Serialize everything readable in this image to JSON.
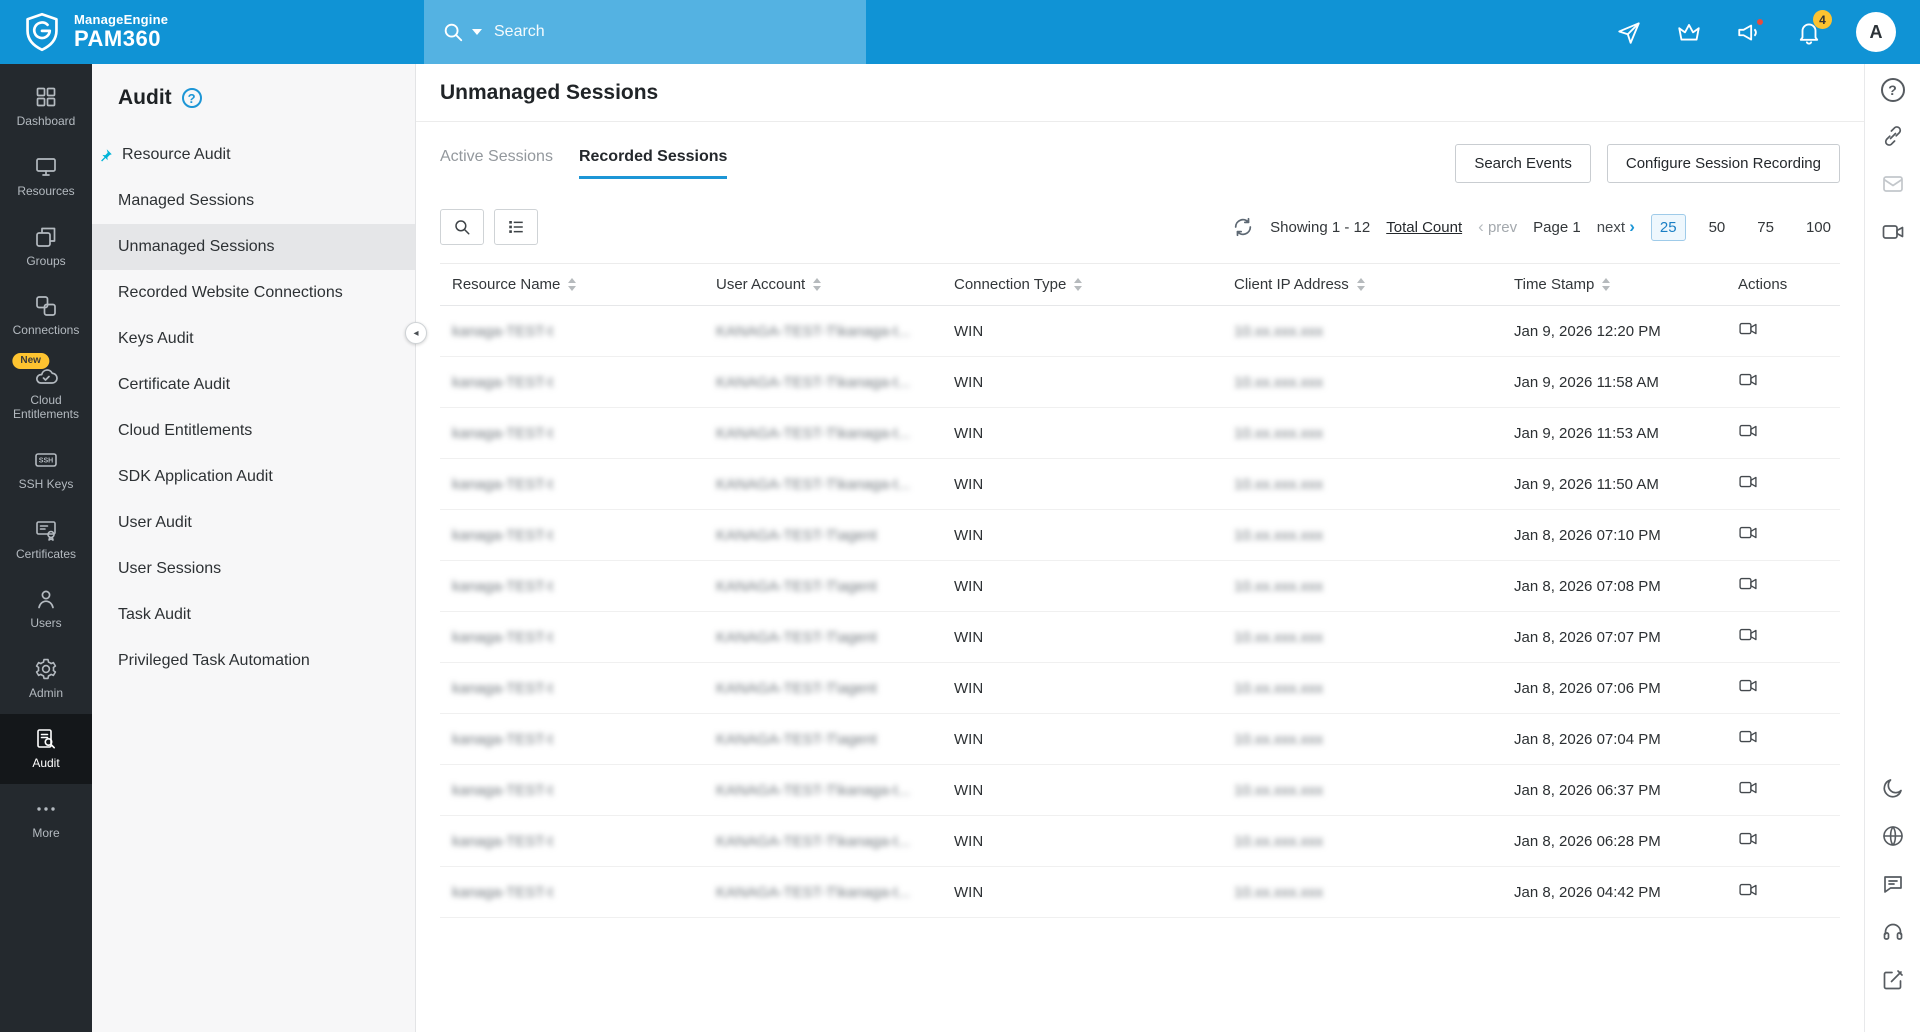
{
  "colors": {
    "topbar_blue": "#1093d5",
    "accent_blue": "#1d96d6",
    "badge_yellow": "#fdc330",
    "alert_red": "#e84c3d",
    "nav_dark": "#24292e"
  },
  "topbar": {
    "brand_line1": "ManageEngine",
    "brand_line2": "PAM360",
    "search_placeholder": "Search",
    "icons": [
      "search-icon",
      "send-icon",
      "crown-icon",
      "announcement-icon",
      "bell-icon"
    ],
    "bell_badge": "4",
    "avatar_letter": "A"
  },
  "nav": {
    "items": [
      {
        "label": "Dashboard",
        "icon": "dashboard-icon"
      },
      {
        "label": "Resources",
        "icon": "resources-icon"
      },
      {
        "label": "Groups",
        "icon": "groups-icon"
      },
      {
        "label": "Connections",
        "icon": "connections-icon"
      },
      {
        "label": "Cloud Entitlements",
        "icon": "cloud-icon",
        "badge": "New"
      },
      {
        "label": "SSH Keys",
        "icon": "ssh-keys-icon"
      },
      {
        "label": "Certificates",
        "icon": "certificates-icon"
      },
      {
        "label": "Users",
        "icon": "users-icon"
      },
      {
        "label": "Admin",
        "icon": "gear-icon"
      },
      {
        "label": "Audit",
        "icon": "audit-icon",
        "active": true
      },
      {
        "label": "More",
        "icon": "more-icon"
      }
    ]
  },
  "sidebar": {
    "title": "Audit",
    "help_icon": "help-icon",
    "items": [
      {
        "label": "Resource Audit",
        "pinned": true
      },
      {
        "label": "Managed Sessions"
      },
      {
        "label": "Unmanaged Sessions",
        "active": true
      },
      {
        "label": "Recorded Website Connections"
      },
      {
        "label": "Keys Audit"
      },
      {
        "label": "Certificate Audit"
      },
      {
        "label": "Cloud Entitlements"
      },
      {
        "label": "SDK Application Audit"
      },
      {
        "label": "User Audit"
      },
      {
        "label": "User Sessions"
      },
      {
        "label": "Task Audit"
      },
      {
        "label": "Privileged Task Automation"
      }
    ]
  },
  "main": {
    "page_title": "Unmanaged Sessions",
    "tabs": [
      {
        "label": "Active Sessions",
        "active": false
      },
      {
        "label": "Recorded Sessions",
        "active": true
      }
    ],
    "actions": {
      "search_events": "Search Events",
      "configure": "Configure Session Recording"
    },
    "pagination": {
      "showing": "Showing 1 - 12",
      "total_link": "Total Count",
      "prev_label": "prev",
      "page_label": "Page 1",
      "next_label": "next",
      "page_sizes": [
        "25",
        "50",
        "75",
        "100"
      ],
      "selected_size": "25"
    },
    "table": {
      "headers": [
        {
          "label": "Resource Name",
          "sortable": true
        },
        {
          "label": "User Account",
          "sortable": true
        },
        {
          "label": "Connection Type",
          "sortable": true
        },
        {
          "label": "Client IP Address",
          "sortable": true
        },
        {
          "label": "Time Stamp",
          "sortable": true
        },
        {
          "label": "Actions",
          "sortable": false
        }
      ],
      "redacted_columns": [
        "Resource Name",
        "User Account",
        "Client IP Address"
      ],
      "rows": [
        {
          "resource": "kanaga-TEST-t",
          "account": "KANAGA-TEST-T\\kanaga-t...",
          "connection_type": "WIN",
          "client_ip": "10.xx.xxx.xxx",
          "time_stamp": "Jan 9, 2026 12:20 PM"
        },
        {
          "resource": "kanaga-TEST-t",
          "account": "KANAGA-TEST-T\\kanaga-t...",
          "connection_type": "WIN",
          "client_ip": "10.xx.xxx.xxx",
          "time_stamp": "Jan 9, 2026 11:58 AM"
        },
        {
          "resource": "kanaga-TEST-t",
          "account": "KANAGA-TEST-T\\kanaga-t...",
          "connection_type": "WIN",
          "client_ip": "10.xx.xxx.xxx",
          "time_stamp": "Jan 9, 2026 11:53 AM"
        },
        {
          "resource": "kanaga-TEST-t",
          "account": "KANAGA-TEST-T\\kanaga-t...",
          "connection_type": "WIN",
          "client_ip": "10.xx.xxx.xxx",
          "time_stamp": "Jan 9, 2026 11:50 AM"
        },
        {
          "resource": "kanaga-TEST-t",
          "account": "KANAGA-TEST-T\\agent",
          "connection_type": "WIN",
          "client_ip": "10.xx.xxx.xxx",
          "time_stamp": "Jan 8, 2026 07:10 PM"
        },
        {
          "resource": "kanaga-TEST-t",
          "account": "KANAGA-TEST-T\\agent",
          "connection_type": "WIN",
          "client_ip": "10.xx.xxx.xxx",
          "time_stamp": "Jan 8, 2026 07:08 PM"
        },
        {
          "resource": "kanaga-TEST-t",
          "account": "KANAGA-TEST-T\\agent",
          "connection_type": "WIN",
          "client_ip": "10.xx.xxx.xxx",
          "time_stamp": "Jan 8, 2026 07:07 PM"
        },
        {
          "resource": "kanaga-TEST-t",
          "account": "KANAGA-TEST-T\\agent",
          "connection_type": "WIN",
          "client_ip": "10.xx.xxx.xxx",
          "time_stamp": "Jan 8, 2026 07:06 PM"
        },
        {
          "resource": "kanaga-TEST-t",
          "account": "KANAGA-TEST-T\\agent",
          "connection_type": "WIN",
          "client_ip": "10.xx.xxx.xxx",
          "time_stamp": "Jan 8, 2026 07:04 PM"
        },
        {
          "resource": "kanaga-TEST-t",
          "account": "KANAGA-TEST-T\\kanaga-t...",
          "connection_type": "WIN",
          "client_ip": "10.xx.xxx.xxx",
          "time_stamp": "Jan 8, 2026 06:37 PM"
        },
        {
          "resource": "kanaga-TEST-t",
          "account": "KANAGA-TEST-T\\kanaga-t...",
          "connection_type": "WIN",
          "client_ip": "10.xx.xxx.xxx",
          "time_stamp": "Jan 8, 2026 06:28 PM"
        },
        {
          "resource": "kanaga-TEST-t",
          "account": "KANAGA-TEST-T\\kanaga-t...",
          "connection_type": "WIN",
          "client_ip": "10.xx.xxx.xxx",
          "time_stamp": "Jan 8, 2026 04:42 PM"
        }
      ]
    }
  },
  "right_rail": {
    "top_icons": [
      "help-icon",
      "link-icon",
      "mail-icon",
      "screen-recorder-icon"
    ],
    "bottom_icons": [
      "moon-icon",
      "translate-globe-icon",
      "chat-icon",
      "support-headset-icon",
      "feedback-compose-icon"
    ]
  },
  "misc": {
    "collapse_arrow": "◂",
    "prev_chevron": "‹",
    "next_chevron": "›"
  }
}
